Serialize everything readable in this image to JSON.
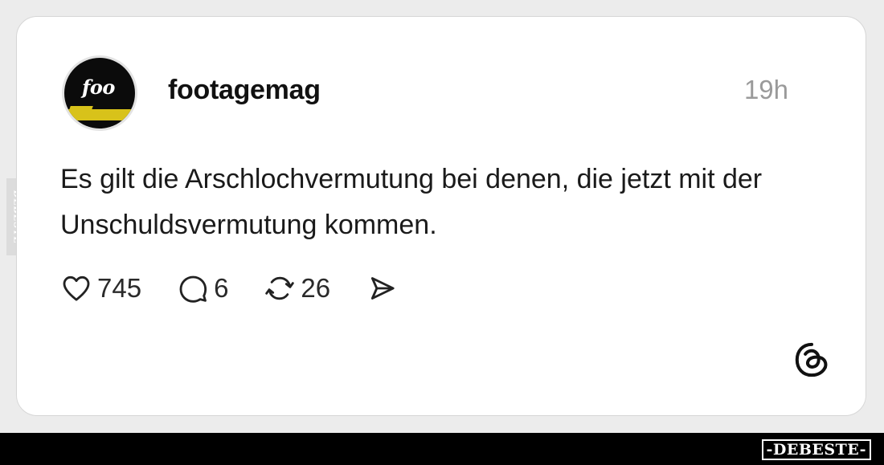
{
  "post": {
    "username": "footagemag",
    "timestamp": "19h",
    "text": "Es gilt die Arschlochvermutung bei denen, die jetzt mit der Unschuldsvermutung kommen.",
    "avatar_text": "foo",
    "likes": "745",
    "replies": "6",
    "reposts": "26"
  },
  "icons": {
    "like": "heart-icon",
    "reply": "comment-icon",
    "repost": "repost-icon",
    "share": "send-icon",
    "platform": "threads-logo-icon"
  },
  "watermark": {
    "bottom": "-DEBESTE-",
    "side": "DEBESTE"
  },
  "colors": {
    "card_background": "#ffffff",
    "page_background": "#ececec",
    "timestamp": "#9a9a9a",
    "text": "#1a1a1a"
  }
}
